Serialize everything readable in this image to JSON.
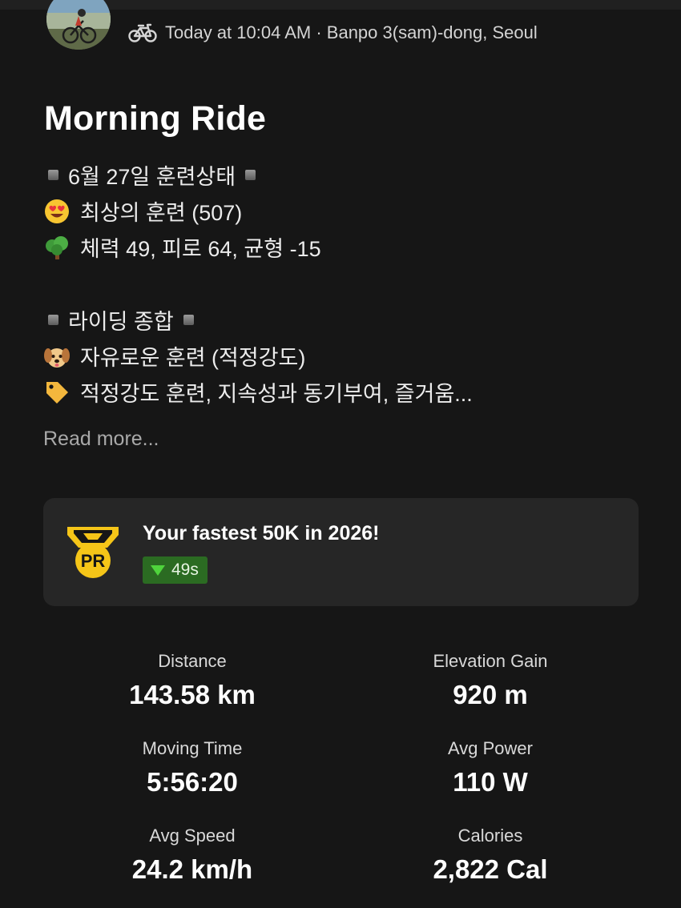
{
  "header": {
    "activity_icon": "bike-icon",
    "meta": "Today at 10:04 AM · Banpo 3(sam)-dong, Seoul"
  },
  "activity": {
    "title": "Morning Ride",
    "description_lines": [
      {
        "icon": "black-square",
        "text": "6월 27일 훈련상태"
      },
      {
        "icon": "heart-eyes-emoji",
        "text": "최상의 훈련 (507)"
      },
      {
        "icon": "tree-emoji",
        "text": "체력 49, 피로 64, 균형 -15"
      },
      {
        "icon": "black-square",
        "text": "라이딩 종합"
      },
      {
        "icon": "dog-face-emoji",
        "text": "자유로운 훈련 (적정강도)"
      },
      {
        "icon": "label-emoji",
        "text": "적정강도 훈련, 지속성과 동기부여, 즐거움..."
      }
    ],
    "read_more": "Read more..."
  },
  "pr": {
    "icon": "pr-medal-icon",
    "medal_text": "PR",
    "title": "Your fastest 50K in 2026!",
    "delta": "49s",
    "colors": {
      "medal": "#f5c518",
      "badge_bg": "#2b6b22",
      "arrow": "#4fd43c"
    }
  },
  "stats": [
    {
      "label": "Distance",
      "value": "143.58 km"
    },
    {
      "label": "Elevation Gain",
      "value": "920 m"
    },
    {
      "label": "Moving Time",
      "value": "5:56:20"
    },
    {
      "label": "Avg Power",
      "value": "110 W"
    },
    {
      "label": "Avg Speed",
      "value": "24.2 km/h"
    },
    {
      "label": "Calories",
      "value": "2,822 Cal"
    }
  ]
}
